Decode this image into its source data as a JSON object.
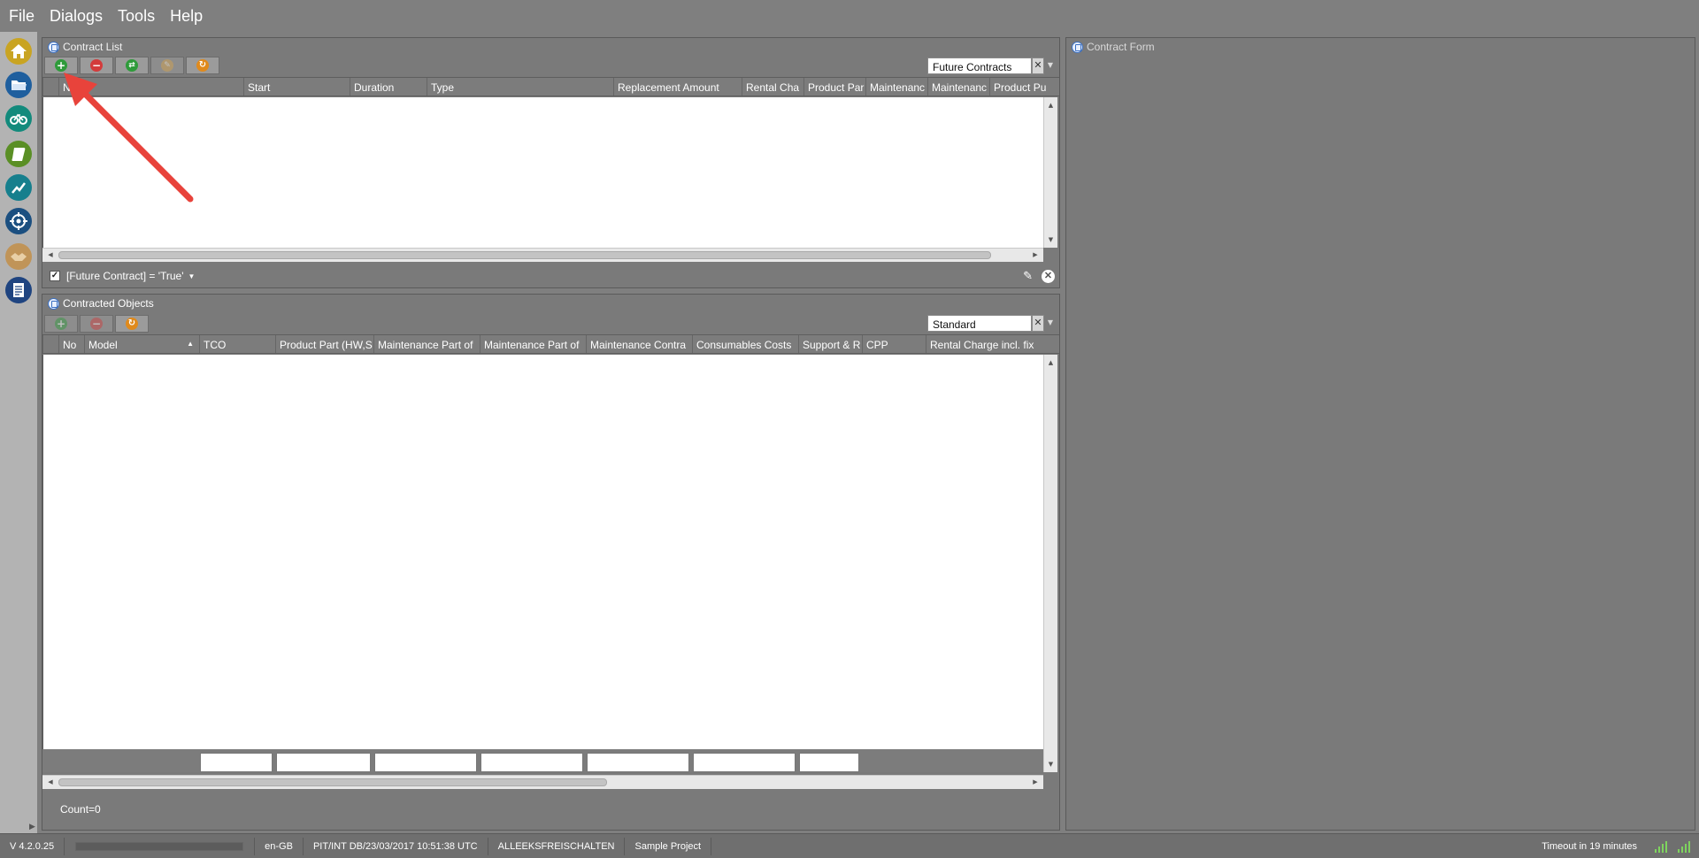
{
  "menu": [
    "File",
    "Dialogs",
    "Tools",
    "Help"
  ],
  "sidebar": {
    "items": [
      {
        "icon": "home-icon",
        "color": "#f0c419"
      },
      {
        "icon": "folder-icon",
        "color": "#1f6fb6"
      },
      {
        "icon": "bicycle-icon",
        "color": "#139a8a"
      },
      {
        "icon": "scroll-icon",
        "color": "#5f9e2b"
      },
      {
        "icon": "trend-chart-icon",
        "color": "#1b8a9a"
      },
      {
        "icon": "target-icon",
        "color": "#1b5f96"
      },
      {
        "icon": "handshake-icon",
        "color": "#c49a5a"
      },
      {
        "icon": "document-list-icon",
        "color": "#1f4f96"
      }
    ]
  },
  "contract_list": {
    "title": "Contract List",
    "toolbar": [
      {
        "icon": "add-icon",
        "color": "#2e9b3a"
      },
      {
        "icon": "remove-icon",
        "color": "#d33b3b"
      },
      {
        "icon": "link-icon",
        "color": "#2e9b3a"
      },
      {
        "icon": "edit-disabled-icon",
        "color": "#d9a54a"
      },
      {
        "icon": "refresh-icon",
        "color": "#e08a1c"
      }
    ],
    "view": "Future Contracts",
    "columns": [
      "Name",
      "Start",
      "Duration",
      "Type",
      "Replacement Amount",
      "Rental Cha",
      "Product Par",
      "Maintenanc",
      "Maintenanc",
      "Product Pu"
    ],
    "filter": "[Future Contract] = 'True'"
  },
  "contracted_objects": {
    "title": "Contracted Objects",
    "view": "Standard",
    "columns": [
      "No",
      "Model",
      "TCO",
      "Product Part (HW,S",
      "Maintenance Part of",
      "Maintenance Part of",
      "Maintenance Contra",
      "Consumables Costs",
      "Support & R",
      "CPP",
      "Rental Charge incl. fix"
    ],
    "count": "Count=0"
  },
  "contract_form": {
    "title": "Contract Form"
  },
  "status": {
    "version": "V 4.2.0.25",
    "locale": "en-GB",
    "db": "PIT/INT DB/23/03/2017 10:51:38 UTC",
    "user": "ALLEEKSFREISCHALTEN",
    "project": "Sample Project",
    "timeout": "Timeout in 19 minutes"
  },
  "annotation_color": "#e8433b"
}
